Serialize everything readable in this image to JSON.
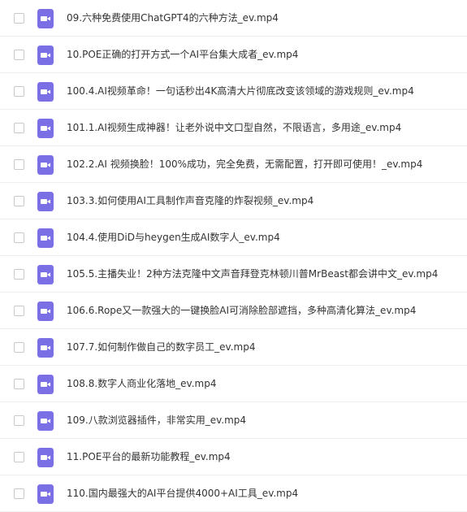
{
  "colors": {
    "icon_purple": "#7B6FE6",
    "row_divider": "#EEEEEE",
    "text": "#333333",
    "checkbox_border": "#C9C9C9"
  },
  "file_icon": "video-file-icon",
  "files": [
    {
      "name": "09.六种免费使用ChatGPT4的六种方法_ev.mp4"
    },
    {
      "name": "10.POE正确的打开方式一个AI平台集大成者_ev.mp4"
    },
    {
      "name": "100.4.AI视频革命！一句话秒出4K高清大片彻底改变该领域的游戏规则_ev.mp4"
    },
    {
      "name": "101.1.AI视频生成神器！让老外说中文口型自然，不限语言，多用途_ev.mp4"
    },
    {
      "name": "102.2.AI 视频换脸！100%成功，完全免费，无需配置，打开即可使用！_ev.mp4"
    },
    {
      "name": "103.3.如何使用AI工具制作声音克隆的炸裂视频_ev.mp4"
    },
    {
      "name": "104.4.使用DiD与heygen生成AI数字人_ev.mp4"
    },
    {
      "name": "105.5.主播失业！2种方法克隆中文声音拜登克林顿川普MrBeast都会讲中文_ev.mp4"
    },
    {
      "name": "106.6.Rope又一款强大的一键换脸AI可消除脸部遮挡，多种高清化算法_ev.mp4"
    },
    {
      "name": "107.7.如何制作做自己的数字员工_ev.mp4"
    },
    {
      "name": "108.8.数字人商业化落地_ev.mp4"
    },
    {
      "name": "109.八款浏览器插件，非常实用_ev.mp4"
    },
    {
      "name": "11.POE平台的最新功能教程_ev.mp4"
    },
    {
      "name": "110.国内最强大的AI平台提供4000+AI工具_ev.mp4"
    }
  ]
}
